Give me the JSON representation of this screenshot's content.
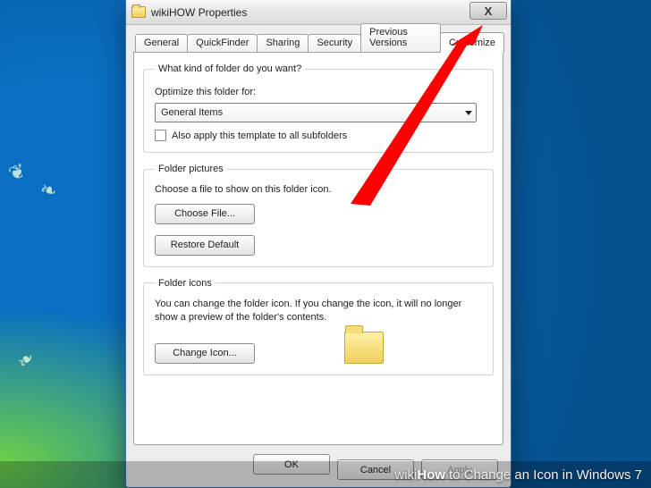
{
  "window": {
    "title": "wikiHOW Properties",
    "close_glyph": "X"
  },
  "tabs": [
    "General",
    "QuickFinder",
    "Sharing",
    "Security",
    "Previous Versions",
    "Customize"
  ],
  "active_tab_index": 5,
  "group_kind": {
    "legend": "What kind of folder do you want?",
    "optimize_label": "Optimize this folder for:",
    "combo_value": "General Items",
    "checkbox_label": "Also apply this template to all subfolders",
    "checkbox_checked": false
  },
  "group_pictures": {
    "legend": "Folder pictures",
    "hint": "Choose a file to show on this folder icon.",
    "choose_btn": "Choose File...",
    "restore_btn": "Restore Default"
  },
  "group_icons": {
    "legend": "Folder icons",
    "hint": "You can change the folder icon. If you change the icon, it will no longer show a preview of the folder's contents.",
    "change_btn": "Change Icon..."
  },
  "footer": {
    "ok": "OK",
    "cancel": "Cancel",
    "apply": "Apply"
  },
  "caption": {
    "wiki": "wiki",
    "how": "How",
    "rest": " to Change an Icon in Windows 7"
  },
  "colors": {
    "arrow": "#ff0000"
  }
}
